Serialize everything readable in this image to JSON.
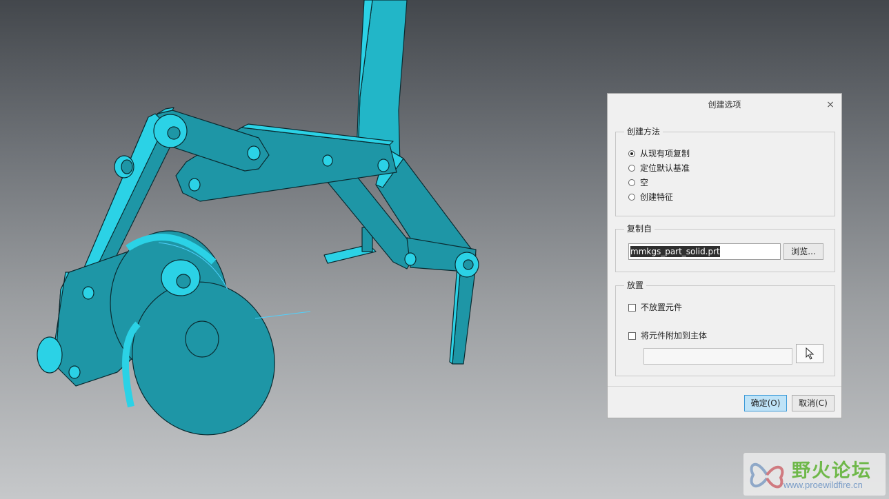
{
  "dialog": {
    "title": "创建选项",
    "close_label": "×",
    "method_group": {
      "legend": "创建方法",
      "options": [
        {
          "label": "从现有项复制",
          "checked": true
        },
        {
          "label": "定位默认基准",
          "checked": false
        },
        {
          "label": "空",
          "checked": false
        },
        {
          "label": "创建特征",
          "checked": false
        }
      ]
    },
    "copy_group": {
      "legend": "复制自",
      "file_value": "mmkgs_part_solid.prt",
      "browse_label": "浏览..."
    },
    "placement_group": {
      "legend": "放置",
      "no_place_label": "不放置元件",
      "attach_label": "将元件附加到主体",
      "attach_input_value": ""
    },
    "ok_label": "确定(O)",
    "cancel_label": "取消(C)"
  },
  "watermark": {
    "title": "野火论坛",
    "url": "www.proewildfire.cn"
  },
  "colors": {
    "model": "#1e96a6",
    "model_light": "#2bd2e6",
    "arrow": "#e03a3a",
    "accent_button": "#bfe3f7"
  }
}
